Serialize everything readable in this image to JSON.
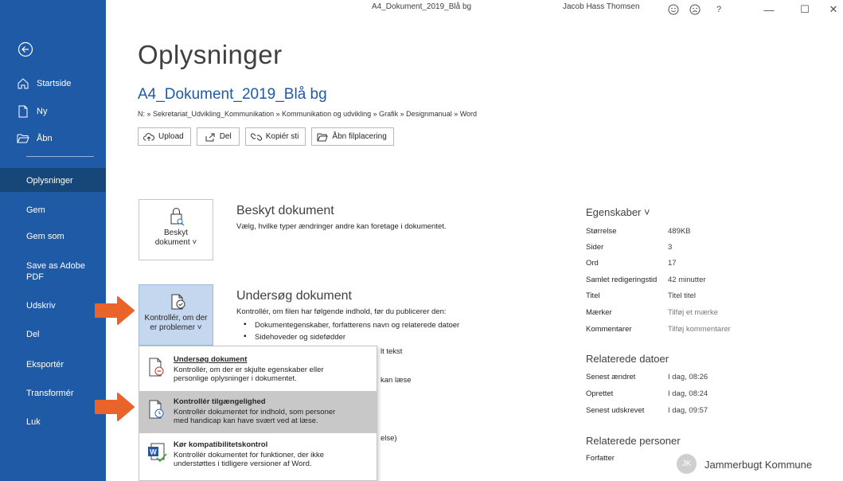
{
  "window": {
    "title": "A4_Dokument_2019_Blå bg",
    "user": "Jacob Hass Thomsen",
    "help": "?",
    "minimize": "—",
    "maximize": "☐",
    "close": "✕"
  },
  "sidebar": {
    "top_items": [
      {
        "label": "Startside",
        "icon": "home-icon"
      },
      {
        "label": "Ny",
        "icon": "new-document-icon"
      },
      {
        "label": "Åbn",
        "icon": "open-folder-icon"
      }
    ],
    "items": [
      {
        "label": "Oplysninger"
      },
      {
        "label": "Gem"
      },
      {
        "label": "Gem som"
      },
      {
        "label": "Save as Adobe PDF"
      },
      {
        "label": "Udskriv"
      },
      {
        "label": "Del"
      },
      {
        "label": "Eksportér"
      },
      {
        "label": "Transformér"
      },
      {
        "label": "Luk"
      }
    ],
    "active": "Oplysninger"
  },
  "main": {
    "page_title": "Oplysninger",
    "doc_name": "A4_Dokument_2019_Blå bg",
    "path": "N: » Sekretariat_Udvikling_Kommunikation » Kommunikation og udvikling » Grafik » Designmanual » Word",
    "buttons": [
      "Upload",
      "Del",
      "Kopiér sti",
      "Åbn filplacering"
    ],
    "protect": {
      "tile_label_1": "Beskyt",
      "tile_label_2": "dokument ˅",
      "heading": "Beskyt dokument",
      "text": "Vælg, hvilke typer ændringer andre kan foretage i dokumentet."
    },
    "inspect": {
      "tile_label_1": "Kontrollér, om der",
      "tile_label_2": "er problemer ˅",
      "heading": "Undersøg dokument",
      "text": "Kontrollér, om filen har følgende indhold, før du publicerer den:",
      "bullets": [
        "Dokumentegenskaber, forfatterens navn og relaterede datoer",
        "Sidehoveder og sidefødder"
      ],
      "partial_1": "lt tekst",
      "partial_2": "kan læse",
      "partial_3": "else)"
    },
    "dropdown": [
      {
        "title": "Undersøg dokument",
        "desc_1": "Kontrollér, om der er skjulte egenskaber eller",
        "desc_2": "personlige oplysninger i dokumentet."
      },
      {
        "title": "Kontrollér tilgængelighed",
        "desc_1": "Kontrollér dokumentet for indhold, som personer",
        "desc_2": "med handicap kan have svært ved at læse."
      },
      {
        "title": "Kør kompatibilitetskontrol",
        "desc_1": "Kontrollér dokumentet for funktioner, der ikke",
        "desc_2": "understøttes i tidligere versioner af Word."
      }
    ]
  },
  "properties": {
    "heading": "Egenskaber ˅",
    "rows": [
      {
        "label": "Størrelse",
        "value": "489KB"
      },
      {
        "label": "Sider",
        "value": "3"
      },
      {
        "label": "Ord",
        "value": "17"
      },
      {
        "label": "Samlet redigeringstid",
        "value": "42 minutter"
      },
      {
        "label": "Titel",
        "value": "Titel titel"
      },
      {
        "label": "Mærker",
        "value": "Tilføj et mærke"
      },
      {
        "label": "Kommentarer",
        "value": "Tilføj kommentarer"
      }
    ],
    "dates_heading": "Relaterede datoer",
    "dates": [
      {
        "label": "Senest ændret",
        "value": "I dag, 08:26"
      },
      {
        "label": "Oprettet",
        "value": "I dag, 08:24"
      },
      {
        "label": "Senest udskrevet",
        "value": "I dag, 09:57"
      }
    ],
    "people_heading": "Relaterede personer",
    "author_label": "Forfatter",
    "author_initials": "JK",
    "author_name": "Jammerbugt Kommune"
  },
  "colors": {
    "sidebar": "#1f5aa6",
    "sidebar_active": "#174679",
    "accent_arrow": "#e8642a",
    "tile_active": "#c5d7ef"
  }
}
